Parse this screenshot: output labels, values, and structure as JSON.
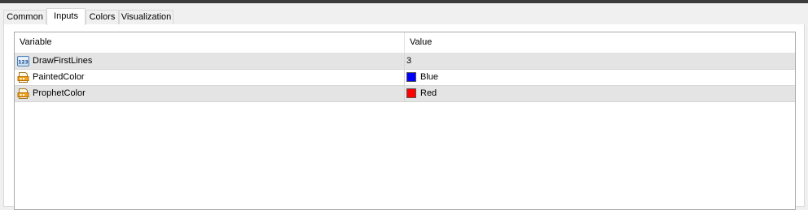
{
  "tabs": [
    {
      "label": "Common"
    },
    {
      "label": "Inputs"
    },
    {
      "label": "Colors"
    },
    {
      "label": "Visualization"
    }
  ],
  "active_tab": "Inputs",
  "table": {
    "headers": {
      "variable": "Variable",
      "value": "Value"
    },
    "rows": [
      {
        "name": "DrawFirstLines",
        "value": "3",
        "type_icon": "integer-123-icon"
      },
      {
        "name": "PaintedColor",
        "value": "Blue",
        "type_icon": "color-parameter-icon",
        "swatch": "#0000ff"
      },
      {
        "name": "ProphetColor",
        "value": "Red",
        "type_icon": "color-parameter-icon",
        "swatch": "#ff0000"
      }
    ]
  }
}
